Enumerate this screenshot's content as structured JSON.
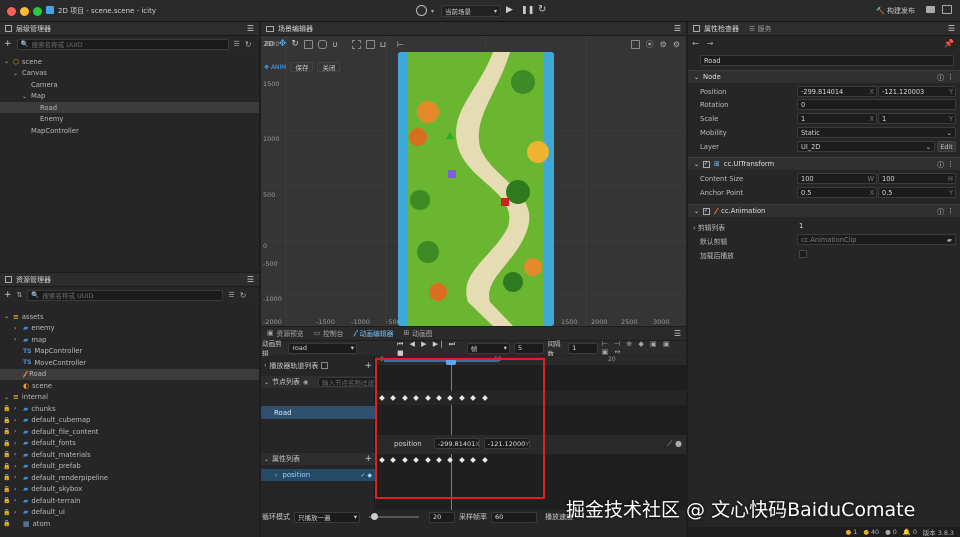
{
  "window": {
    "title": "2D 项目 - scene.scene - icity"
  },
  "top_toolbar": {
    "scene_select": "当前场景",
    "build_publish": "构建发布"
  },
  "hierarchy": {
    "title": "层级管理器",
    "search_placeholder": "搜索名称或 UUID",
    "nodes": [
      {
        "label": "scene",
        "depth": 0,
        "expanded": true,
        "selected": false
      },
      {
        "label": "Canvas",
        "depth": 1,
        "expanded": true,
        "selected": false
      },
      {
        "label": "Camera",
        "depth": 2,
        "expanded": false,
        "selected": false
      },
      {
        "label": "Map",
        "depth": 2,
        "expanded": true,
        "selected": false
      },
      {
        "label": "Road",
        "depth": 3,
        "expanded": false,
        "selected": true
      },
      {
        "label": "Enemy",
        "depth": 3,
        "expanded": false,
        "selected": false
      },
      {
        "label": "MapController",
        "depth": 2,
        "expanded": false,
        "selected": false
      }
    ]
  },
  "assets": {
    "title": "资源管理器",
    "search_placeholder": "搜索名称或 UUID",
    "items": [
      {
        "label": "assets",
        "kind": "db",
        "depth": 0
      },
      {
        "label": "enemy",
        "kind": "folder",
        "depth": 1
      },
      {
        "label": "map",
        "kind": "folder",
        "depth": 1
      },
      {
        "label": "MapController",
        "kind": "ts",
        "depth": 1
      },
      {
        "label": "MoveController",
        "kind": "ts",
        "depth": 1
      },
      {
        "label": "Road",
        "kind": "anim",
        "depth": 1
      },
      {
        "label": "scene",
        "kind": "scene",
        "depth": 1
      },
      {
        "label": "internal",
        "kind": "db",
        "depth": 0
      },
      {
        "label": "chunks",
        "kind": "folder",
        "depth": 1
      },
      {
        "label": "default_cubemap",
        "kind": "folder",
        "depth": 1
      },
      {
        "label": "default_file_content",
        "kind": "folder",
        "depth": 1
      },
      {
        "label": "default_fonts",
        "kind": "folder",
        "depth": 1
      },
      {
        "label": "default_materials",
        "kind": "folder",
        "depth": 1
      },
      {
        "label": "default_prefab",
        "kind": "folder",
        "depth": 1
      },
      {
        "label": "default_renderpipeline",
        "kind": "folder",
        "depth": 1
      },
      {
        "label": "default_skybox",
        "kind": "folder",
        "depth": 1
      },
      {
        "label": "default-terrain",
        "kind": "folder",
        "depth": 1
      },
      {
        "label": "default_ui",
        "kind": "folder",
        "depth": 1
      },
      {
        "label": "atom",
        "kind": "file",
        "depth": 1
      }
    ]
  },
  "scene_editor": {
    "title": "场景编辑器",
    "mode_2d": "2D",
    "anim_tag": "ANIM",
    "save": "保存",
    "close": "关闭",
    "y_ticks": [
      "2000",
      "1500",
      "1000",
      "500",
      "0",
      "-500",
      "-1000"
    ],
    "x_ticks": [
      "-2000",
      "-1500",
      "-1000",
      "-500",
      "500",
      "1000",
      "1500",
      "2000",
      "2500",
      "3000"
    ]
  },
  "bottom_tabs": {
    "tabs": [
      {
        "label": "资源预览",
        "active": false
      },
      {
        "label": "控制台",
        "active": false
      },
      {
        "label": "动画编辑器",
        "active": true
      },
      {
        "label": "动画图",
        "active": false
      }
    ]
  },
  "animation_editor": {
    "clip_label": "动画剪辑",
    "clip_value": "road",
    "frame_label": "帧",
    "frame_value": "5",
    "spacing_label": "间隔数",
    "spacing_value": "1",
    "ruler_ticks": [
      "0",
      "10",
      "20"
    ],
    "player_tracks": "播放器轨道列表",
    "node_list": "节点列表",
    "node_search_placeholder": "输入节点名称过滤",
    "node_name": "Road",
    "prop_list": "属性列表",
    "prop_name": "position",
    "prop_row": {
      "name": "position",
      "x": "-299.81401",
      "y": "-121.12000",
      "x_label": "X",
      "y_label": "Y"
    },
    "loop_label": "循环模式",
    "loop_value": "只播放一遍",
    "speed_value": "20",
    "sample_label": "采样帧率",
    "sample_value": "60",
    "duration_label": "播放速度"
  },
  "inspector": {
    "title": "属性检查器",
    "service_tab": "服务",
    "node_name": "Road",
    "node_section": "Node",
    "position": {
      "label": "Position",
      "x": "-299.814014",
      "y": "-121.120003",
      "x_axis": "X",
      "y_axis": "Y"
    },
    "rotation": {
      "label": "Rotation",
      "value": "0"
    },
    "scale": {
      "label": "Scale",
      "x": "1",
      "y": "1",
      "x_axis": "X",
      "y_axis": "Y"
    },
    "mobility": {
      "label": "Mobility",
      "value": "Static"
    },
    "layer": {
      "label": "Layer",
      "value": "UI_2D",
      "edit": "Edit"
    },
    "ui_transform": "cc.UITransform",
    "content_size": {
      "label": "Content Size",
      "w": "100",
      "h": "100",
      "w_axis": "W",
      "h_axis": "H"
    },
    "anchor_point": {
      "label": "Anchor Point",
      "x": "0.5",
      "y": "0.5",
      "x_axis": "X",
      "y_axis": "Y"
    },
    "animation": "cc.Animation",
    "clips": {
      "label": "剪辑列表",
      "value": "1"
    },
    "default_clip": {
      "label": "默认剪辑",
      "value": "cc.AnimationClip"
    },
    "play_on_load": {
      "label": "加载后播放"
    }
  },
  "statusbar": {
    "info": "1",
    "warn": "40",
    "error": "0",
    "logs": "0",
    "version": "版本 3.8.3"
  },
  "watermark": "掘金技术社区 @ 文心快码BaiduComate",
  "colors": {
    "accent": "#3f8fd8",
    "highlight_red": "#e02020",
    "selected": "#3c3c3c",
    "tab_active": "#6fc2ff"
  }
}
